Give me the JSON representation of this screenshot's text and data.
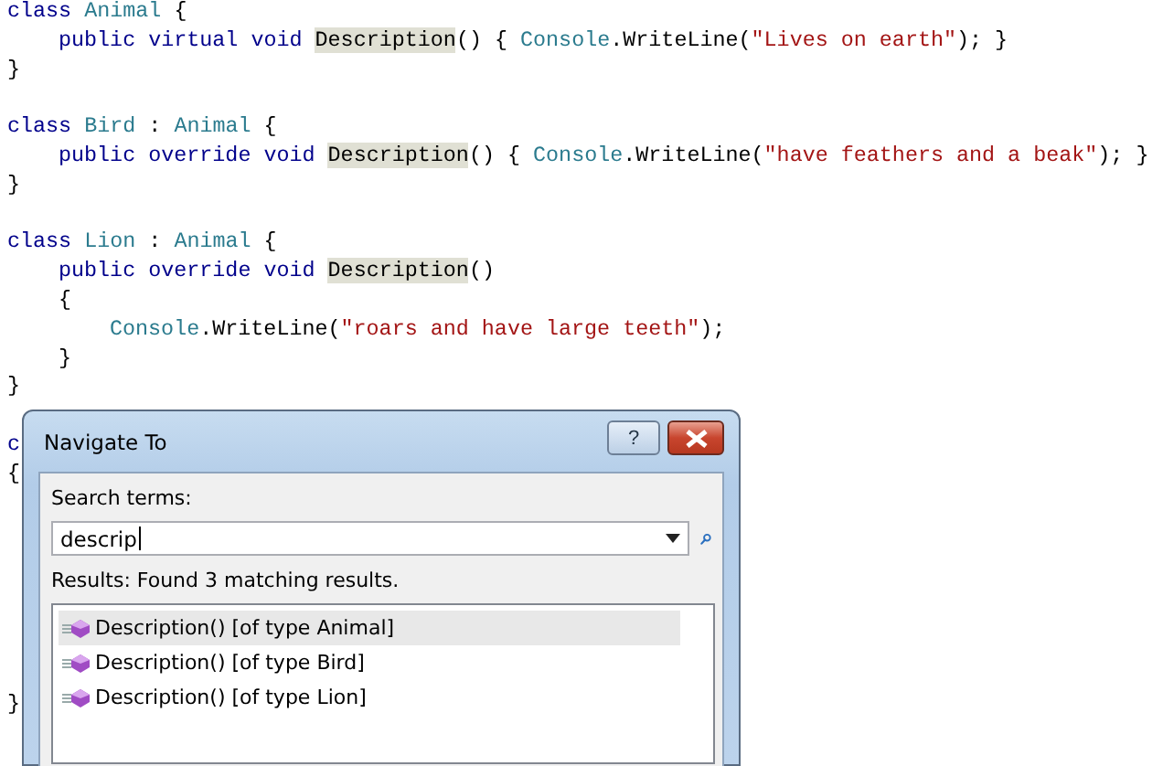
{
  "code_lines": [
    {
      "kind": "code",
      "tokens": [
        {
          "kind": "kw",
          "text": "class "
        },
        {
          "kind": "type",
          "text": "Animal"
        },
        {
          "kind": "plain",
          "text": " {"
        }
      ],
      "children": [
        {
          "kind": "code",
          "tokens": [
            {
              "kind": "kw",
              "text": "public virtual void "
            },
            {
              "kind": "hl",
              "text": "Description"
            },
            {
              "kind": "plain",
              "text": "() { "
            },
            {
              "kind": "type",
              "text": "Console"
            },
            {
              "kind": "plain",
              "text": ".WriteLine("
            },
            {
              "kind": "str",
              "text": "\"Lives on earth\""
            },
            {
              "kind": "plain",
              "text": "); }"
            }
          ]
        }
      ]
    },
    {
      "kind": "code",
      "tokens": [
        {
          "kind": "plain",
          "text": "}"
        }
      ]
    },
    {
      "kind": "blank"
    },
    {
      "kind": "code",
      "tokens": [
        {
          "kind": "kw",
          "text": "class "
        },
        {
          "kind": "type",
          "text": "Bird"
        },
        {
          "kind": "plain",
          "text": " : "
        },
        {
          "kind": "type",
          "text": "Animal"
        },
        {
          "kind": "plain",
          "text": " {"
        }
      ],
      "children": [
        {
          "kind": "code",
          "tokens": [
            {
              "kind": "kw",
              "text": "public override void "
            },
            {
              "kind": "hl",
              "text": "Description"
            },
            {
              "kind": "plain",
              "text": "() { "
            },
            {
              "kind": "type",
              "text": "Console"
            },
            {
              "kind": "plain",
              "text": ".WriteLine("
            },
            {
              "kind": "str",
              "text": "\"have feathers and a beak\""
            },
            {
              "kind": "plain",
              "text": "); }"
            }
          ]
        }
      ]
    },
    {
      "kind": "code",
      "tokens": [
        {
          "kind": "plain",
          "text": "}"
        }
      ]
    },
    {
      "kind": "blank"
    },
    {
      "kind": "code",
      "tokens": [
        {
          "kind": "kw",
          "text": "class "
        },
        {
          "kind": "type",
          "text": "Lion"
        },
        {
          "kind": "plain",
          "text": " : "
        },
        {
          "kind": "type",
          "text": "Animal"
        },
        {
          "kind": "plain",
          "text": " {"
        }
      ],
      "children": [
        {
          "kind": "code",
          "tokens": [
            {
              "kind": "kw",
              "text": "public override void "
            },
            {
              "kind": "hl",
              "text": "Description"
            },
            {
              "kind": "plain",
              "text": "()"
            }
          ]
        },
        {
          "kind": "code",
          "tokens": [
            {
              "kind": "plain",
              "text": "{"
            }
          ],
          "children": [
            {
              "kind": "code",
              "tokens": [
                {
                  "kind": "type",
                  "text": "Console"
                },
                {
                  "kind": "plain",
                  "text": ".WriteLine("
                },
                {
                  "kind": "str",
                  "text": "\"roars and have large teeth\""
                },
                {
                  "kind": "plain",
                  "text": ");"
                }
              ]
            }
          ]
        },
        {
          "kind": "code",
          "tokens": [
            {
              "kind": "plain",
              "text": "}"
            }
          ]
        }
      ]
    },
    {
      "kind": "code",
      "tokens": [
        {
          "kind": "plain",
          "text": "}"
        }
      ]
    },
    {
      "kind": "blank"
    },
    {
      "kind": "code",
      "tokens": [
        {
          "kind": "kw",
          "text": "c"
        }
      ]
    },
    {
      "kind": "code",
      "tokens": [
        {
          "kind": "plain",
          "text": "{"
        }
      ]
    },
    {
      "kind": "blank"
    },
    {
      "kind": "blank"
    },
    {
      "kind": "blank"
    },
    {
      "kind": "blank"
    },
    {
      "kind": "blank"
    },
    {
      "kind": "blank"
    },
    {
      "kind": "blank"
    },
    {
      "kind": "code",
      "tokens": [
        {
          "kind": "plain",
          "text": "}"
        }
      ]
    }
  ],
  "dialog": {
    "title": "Navigate To",
    "help": "?",
    "search_label": "Search terms:",
    "search_value": "descrip",
    "results_label": "Results: Found 3 matching results.",
    "results": [
      {
        "label": "Description() [of type Animal]",
        "selected": true
      },
      {
        "label": "Description() [of type Bird]",
        "selected": false
      },
      {
        "label": "Description() [of type Lion]",
        "selected": false
      }
    ]
  }
}
